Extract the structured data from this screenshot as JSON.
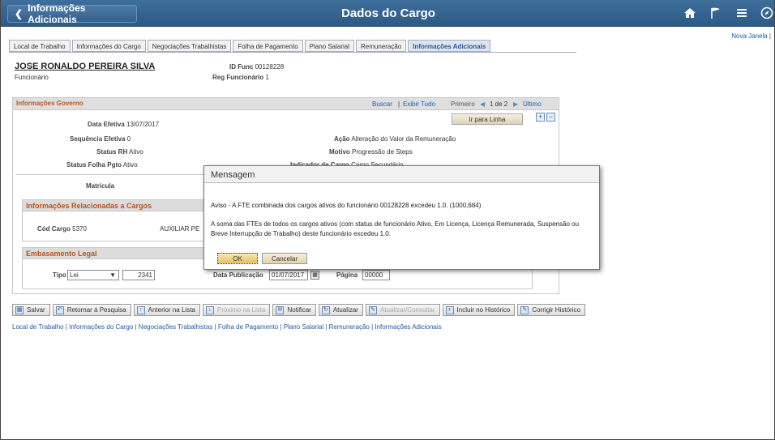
{
  "header": {
    "back_label": "Informações Adicionais",
    "title": "Dados do Cargo",
    "icons": [
      "home-icon",
      "flag-icon",
      "menu-icon",
      "compass-icon"
    ]
  },
  "nova_janela": "Nova Janela |",
  "tabs": [
    {
      "label": "Local de Trabalho",
      "active": false
    },
    {
      "label": "Informações do Cargo",
      "active": false
    },
    {
      "label": "Negociações Trabalhistas",
      "active": false
    },
    {
      "label": "Folha de Pagamento",
      "active": false
    },
    {
      "label": "Plano Salarial",
      "active": false
    },
    {
      "label": "Remuneração",
      "active": false
    },
    {
      "label": "Informações Adicionais",
      "active": true
    }
  ],
  "employee": {
    "name": "JOSE RONALDO PEREIRA SILVA",
    "role": "Funcionário",
    "id_label": "ID Func",
    "id_value": "00128228",
    "reg_label": "Reg Funcionário",
    "reg_value": "1"
  },
  "panel": {
    "title": "Informações Governo",
    "buscar": "Buscar",
    "exibir": "Exibir Tudo",
    "primeiro": "Primeiro",
    "count": "1 de 2",
    "ultimo": "Último",
    "ir_para": "Ir para Linha",
    "fields": {
      "data_efetiva_label": "Data Efetiva",
      "data_efetiva": "13/07/2017",
      "sequencia_label": "Sequência Efetiva",
      "sequencia": "0",
      "status_rh_label": "Status RH",
      "status_rh": "Ativo",
      "status_folha_label": "Status Folha Pgto",
      "status_folha": "Ativo",
      "acao_label": "Ação",
      "acao": "Alteração do Valor da Remuneração",
      "motivo_label": "Motivo",
      "motivo": "Progressão de Steps",
      "indicador_label": "Indicador de Cargo",
      "indicador": "Cargo Secundário",
      "matricula_label": "Matrícula"
    },
    "cargos": {
      "title": "Informações Relacionadas a Cargos",
      "cod_label": "Cód Cargo",
      "cod": "5370",
      "desc": "AUXILIAR PE"
    },
    "legal": {
      "title": "Embasamento Legal",
      "tipo_label": "Tipo",
      "tipo": "Lei",
      "numero": "2341",
      "data_pub_label": "Data Publicação",
      "data_pub": "01/07/2017",
      "pagina_label": "Página",
      "pagina": "00000"
    }
  },
  "toolbar": [
    {
      "label": "Salvar",
      "icon": "save-icon",
      "enabled": true
    },
    {
      "label": "Retornar á Pesquisa",
      "icon": "return-search-icon",
      "enabled": true
    },
    {
      "label": "Anterior na Lista",
      "icon": "previous-icon",
      "enabled": true
    },
    {
      "label": "Próximo na Lista",
      "icon": "next-icon",
      "enabled": false
    },
    {
      "label": "Notificar",
      "icon": "notify-icon",
      "enabled": true
    },
    {
      "label": "Atualizar",
      "icon": "refresh-icon",
      "enabled": true
    },
    {
      "label": "Atualizar/Consultar",
      "icon": "update-query-icon",
      "enabled": false
    },
    {
      "label": "Incluir no Histórico",
      "icon": "add-history-icon",
      "enabled": true
    },
    {
      "label": "Corrigir Histórico",
      "icon": "correct-history-icon",
      "enabled": true
    }
  ],
  "bottom_links": "Local de Trabalho | Informações do Cargo | Negociações Trabalhistas | Folha de Pagamento | Plano Salarial | Remuneração | Informações Adicionais",
  "modal": {
    "title": "Mensagem",
    "line1": "Aviso - A FTE combinada dos cargos ativos do funcionário 00128228 excedeu 1.0. (1000,684)",
    "line2": "A soma das FTEs de todos os cargos ativos (com status de funcionário Ativo, Em Licença, Licença Remunerada, Suspensão ou Breve Interrupção de Trabalho) deste funcionário excedeu 1.0.",
    "ok": "OK",
    "cancel": "Cancelar"
  },
  "colors": {
    "header_bg": "#3a6896",
    "section_title": "#b8541c",
    "link": "#1f5aa6"
  }
}
